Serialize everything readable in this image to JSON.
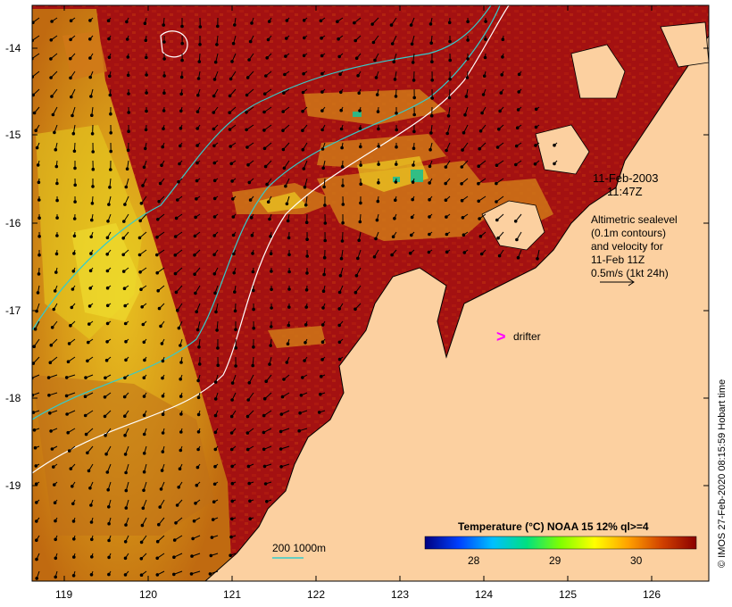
{
  "map": {
    "lon_ticks": [
      "119",
      "120",
      "121",
      "122",
      "123",
      "124",
      "125",
      "126"
    ],
    "lat_ticks": [
      "-14",
      "-15",
      "-16",
      "-17",
      "-18",
      "-19"
    ]
  },
  "date_label": {
    "line1": "11-Feb-2003",
    "line2": "11:47Z"
  },
  "altimetry_note": {
    "lines": [
      "Altimetric sealevel",
      "(0.1m contours)",
      "and velocity for",
      "11-Feb 11Z",
      "0.5m/s (1kt 24h)"
    ]
  },
  "drifter": {
    "symbol": ">",
    "label": "drifter",
    "color": "#ff00ff"
  },
  "isobath_legend": {
    "label": "200  1000m",
    "color": "#33cccc"
  },
  "colorbar": {
    "title": "Temperature (°C) NOAA 15 12% ql>=4",
    "ticks": [
      "28",
      "29",
      "30"
    ],
    "stops": [
      "#000080",
      "#0040ff",
      "#00c0ff",
      "#00e080",
      "#80ff00",
      "#ffff00",
      "#ffa000",
      "#d04000",
      "#8b0000"
    ]
  },
  "credit": "© IMOS 27-Feb-2020 08:15:59 Hobart time",
  "colors": {
    "land": "#fcd0a0",
    "ocean_warm": "#a01010",
    "ocean_mid": "#d06010",
    "swath": "#d8a020"
  }
}
